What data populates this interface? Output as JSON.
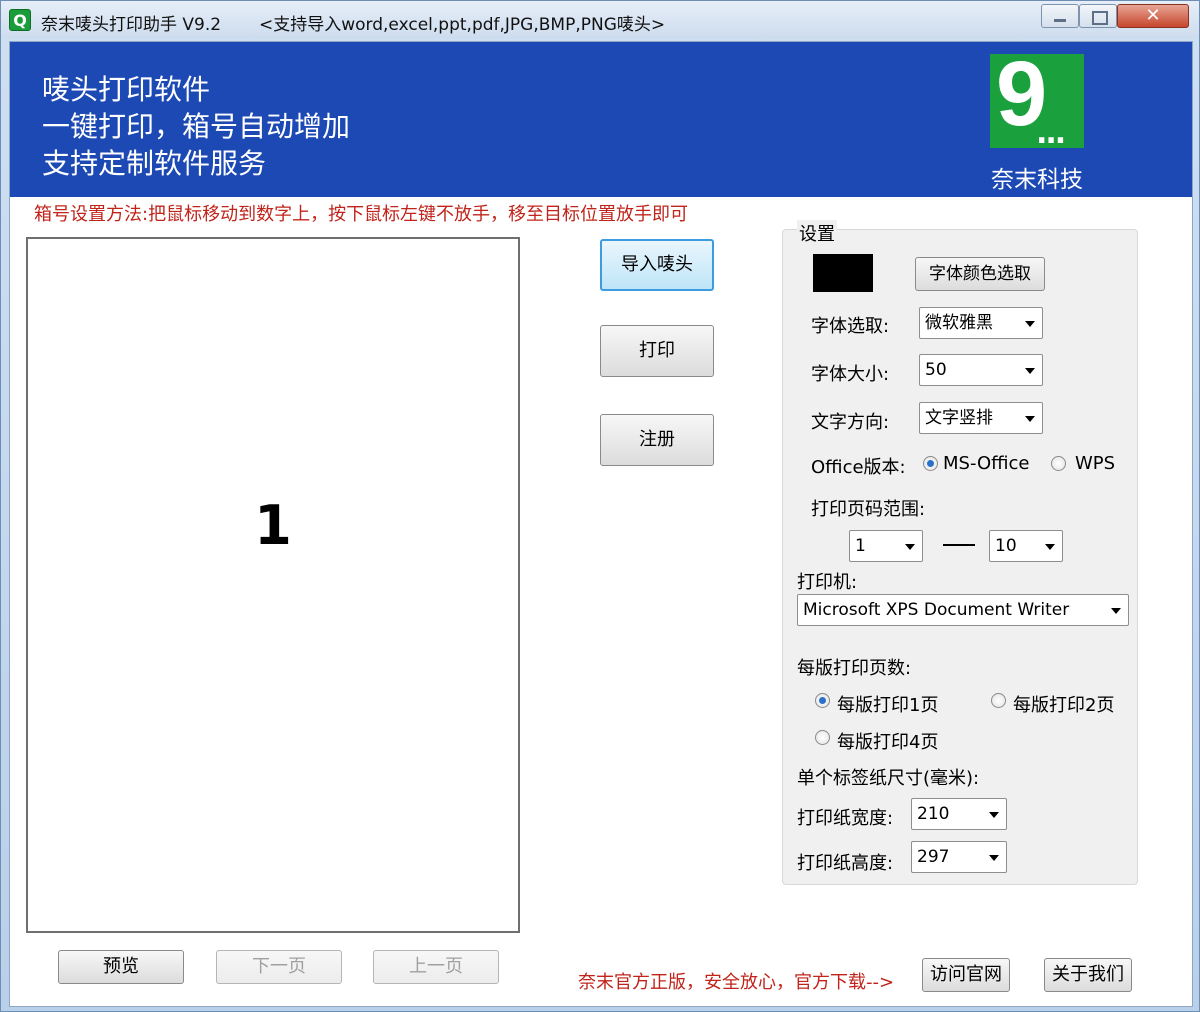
{
  "window": {
    "title": "奈末唛头打印助手  V9.2",
    "subtitle": "<支持导入word,excel,ppt,pdf,JPG,BMP,PNG唛头>",
    "app_icon": "Q",
    "close_glyph": "✕"
  },
  "banner": {
    "line1": "唛头打印软件",
    "line2": "一键打印，箱号自动增加",
    "line3": "支持定制软件服务",
    "logo_glyph": "9",
    "logo_dots": "...",
    "brand": "奈末科技"
  },
  "hint": "箱号设置方法:把鼠标移动到数字上，按下鼠标左键不放手，移至目标位置放手即可",
  "preview": {
    "page_number": "1"
  },
  "actions": {
    "import": "导入唛头",
    "print": "打印",
    "register": "注册"
  },
  "nav": {
    "preview": "预览",
    "next_page": "下一页",
    "prev_page": "上一页"
  },
  "settings": {
    "group_title": "设置",
    "font_color_button": "字体颜色选取",
    "font_color": "#000000",
    "font_label": "字体选取:",
    "font_value": "微软雅黑",
    "size_label": "字体大小:",
    "size_value": "50",
    "direction_label": "文字方向:",
    "direction_value": "文字竖排",
    "office_label": "Office版本:",
    "office_ms": "MS-Office",
    "office_wps": "WPS",
    "office_selected": "MS-Office",
    "range_label": "打印页码范围:",
    "range_from": "1",
    "range_to": "10",
    "printer_label": "打印机:",
    "printer_value": "Microsoft XPS Document Writer",
    "per_sheet_label": "每版打印页数:",
    "per_sheet_1": "每版打印1页",
    "per_sheet_2": "每版打印2页",
    "per_sheet_4": "每版打印4页",
    "per_sheet_selected": "每版打印1页",
    "label_size_title": "单个标签纸尺寸(毫米):",
    "width_label": "打印纸宽度:",
    "width_value": "210",
    "height_label": "打印纸高度:",
    "height_value": "297"
  },
  "footer": {
    "note": "奈末官方正版，安全放心，官方下载-->",
    "visit_site": "访问官网",
    "about": "关于我们"
  }
}
